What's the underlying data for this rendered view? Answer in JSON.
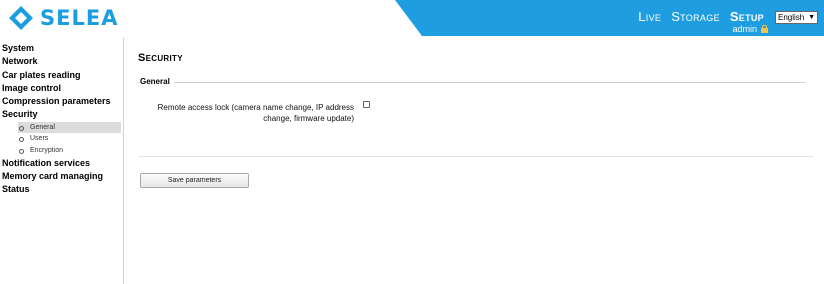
{
  "brand": {
    "name": "SELEA",
    "accent_color": "#1a9ee0",
    "header_blue": "#1e9de0"
  },
  "topnav": {
    "items": [
      {
        "label": "Live",
        "active": false
      },
      {
        "label": "Storage",
        "active": false
      },
      {
        "label": "Setup",
        "active": true
      }
    ],
    "language": "English",
    "user": "admin",
    "user_icon": "lock-icon"
  },
  "sidebar": {
    "items": [
      {
        "label": "System"
      },
      {
        "label": "Network"
      },
      {
        "label": "Car plates reading"
      },
      {
        "label": "Image control"
      },
      {
        "label": "Compression parameters"
      },
      {
        "label": "Security"
      }
    ],
    "security_sub": [
      {
        "label": "General",
        "selected": true
      },
      {
        "label": "Users",
        "selected": false
      },
      {
        "label": "Encryption",
        "selected": false
      }
    ],
    "items_after": [
      {
        "label": "Notification services"
      },
      {
        "label": "Memory card managing"
      },
      {
        "label": "Status"
      }
    ]
  },
  "main": {
    "title": "Security",
    "section_legend": "General",
    "option_label": "Remote access lock (camera name change, IP address change, firmware update)",
    "option_checked": false,
    "save_label": "Save parameters"
  }
}
